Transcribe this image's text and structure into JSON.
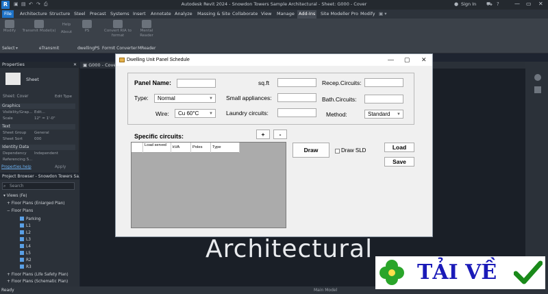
{
  "app": {
    "logo": "R",
    "window_title": "Autodesk Revit 2024 - Snowdon Towers Sample Architectural - Sheet: G000 - Cover",
    "sign_in": "Sign In",
    "window_controls": [
      "—",
      "▭",
      "✕"
    ]
  },
  "ribbon_tabs": [
    "File",
    "Architecture",
    "Structure",
    "Steel",
    "Precast",
    "Systems",
    "Insert",
    "Annotate",
    "Analyze",
    "Massing & Site",
    "Collaborate",
    "View",
    "Manage",
    "Add-Ins",
    "Site Modeller Pro",
    "Modify"
  ],
  "active_tab": "Add-Ins",
  "ribbon": {
    "buttons": [
      "Modify",
      "Transmit Model(s)",
      "Help",
      "About",
      "PS",
      "Convert RIA to format",
      "Mental Reader"
    ],
    "panels": [
      "Select",
      "eTransmit",
      "dwellingPS",
      "FormIt Converter",
      "MReader"
    ]
  },
  "properties": {
    "header": "Properties",
    "type_name": "Sheet",
    "selector": "Sheet: Cover",
    "edit_type": "Edit Type",
    "groups": [
      {
        "label": "Graphics",
        "rows": [
          {
            "k": "Visibility/Grap...",
            "v": "Edit..."
          },
          {
            "k": "Scale",
            "v": "12\" = 1'-0\""
          }
        ]
      },
      {
        "label": "Text",
        "rows": [
          {
            "k": "Sheet Group",
            "v": "General"
          },
          {
            "k": "Sheet Sort",
            "v": "000"
          }
        ]
      },
      {
        "label": "Identity Data",
        "rows": [
          {
            "k": "Dependency",
            "v": "Independent"
          },
          {
            "k": "Referencing S...",
            "v": ""
          }
        ]
      }
    ],
    "help_link": "Properties help",
    "apply": "Apply"
  },
  "browser": {
    "header": "Project Browser - Snowdon Towers Sa...",
    "search_placeholder": "Search",
    "items": [
      "Views (Fe)",
      "Floor Plans (Enlarged Plan)",
      "Floor Plans",
      "Parking",
      "L1",
      "L2",
      "L3",
      "L4",
      "L5",
      "R2",
      "R3",
      "Floor Plans (Life Safety Plan)",
      "Floor Plans (Schematic Plan)"
    ]
  },
  "view_tab": "G000 - Cover",
  "view_text": "Architectural",
  "status": {
    "left": "Ready",
    "model": "Main Model"
  },
  "dialog": {
    "title": "Dwelling Unit Panel Schedule",
    "panel_name_label": "Panel Name:",
    "type_label": "Type:",
    "type_value": "Normal",
    "wire_label": "Wire:",
    "wire_value": "Cu 60°C",
    "sqft_label": "sq.ft",
    "small_appl_label": "Small appliances:",
    "laundry_label": "Laundry circuits:",
    "recep_label": "Recep.Circuits:",
    "bath_label": "Bath.Circuits:",
    "method_label": "Method:",
    "method_value": "Standard",
    "specific_label": "Specific circuits:",
    "plus": "+",
    "minus": "-",
    "columns": [
      "Load served",
      "kVA",
      "Poles",
      "Type"
    ],
    "draw": "Draw",
    "draw_sld": "Draw SLD",
    "load": "Load",
    "save": "Save"
  },
  "watermark": {
    "text": "TẢI VỀ",
    "check_color": "#1a8a1a",
    "clover_color": "#2aa52a"
  }
}
